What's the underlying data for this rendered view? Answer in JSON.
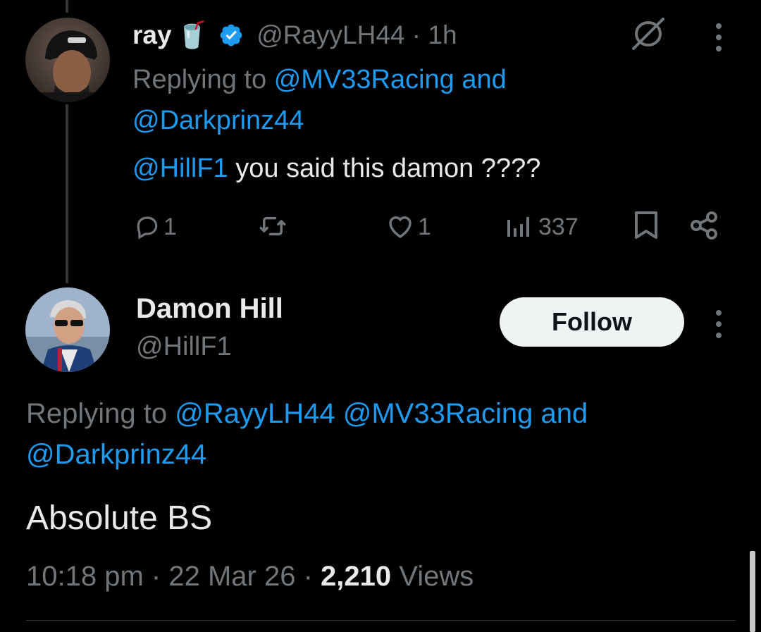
{
  "colors": {
    "background": "#000000",
    "accent": "#1d9bf0",
    "muted": "#71767b",
    "text": "#e7e9ea"
  },
  "reply_tweet": {
    "display_name": "ray",
    "name_emoji": "🥤",
    "verified_icon": "verified-badge-icon",
    "handle": "@RayyLH44",
    "separator": "·",
    "time": "1h",
    "replying_prefix": "Replying to",
    "replying_user1": "@MV33Racing",
    "replying_and": "and",
    "replying_user2": "@Darkprinz44",
    "mention": "@HillF1",
    "text": "you said this damon ????",
    "actions": {
      "reply_count": "1",
      "retweet_count": "",
      "like_count": "1",
      "views_count": "337"
    }
  },
  "main_tweet": {
    "display_name": "Damon Hill",
    "handle": "@HillF1",
    "follow_label": "Follow",
    "replying_prefix": "Replying to",
    "replying_user1": "@RayyLH44",
    "replying_user2": "@MV33Racing",
    "replying_and": "and",
    "replying_user3": "@Darkprinz44",
    "text": "Absolute BS",
    "time": "10:18 pm",
    "sep1": "·",
    "date": "22 Mar 26",
    "sep2": "·",
    "views": "2,210",
    "views_label": "Views"
  }
}
